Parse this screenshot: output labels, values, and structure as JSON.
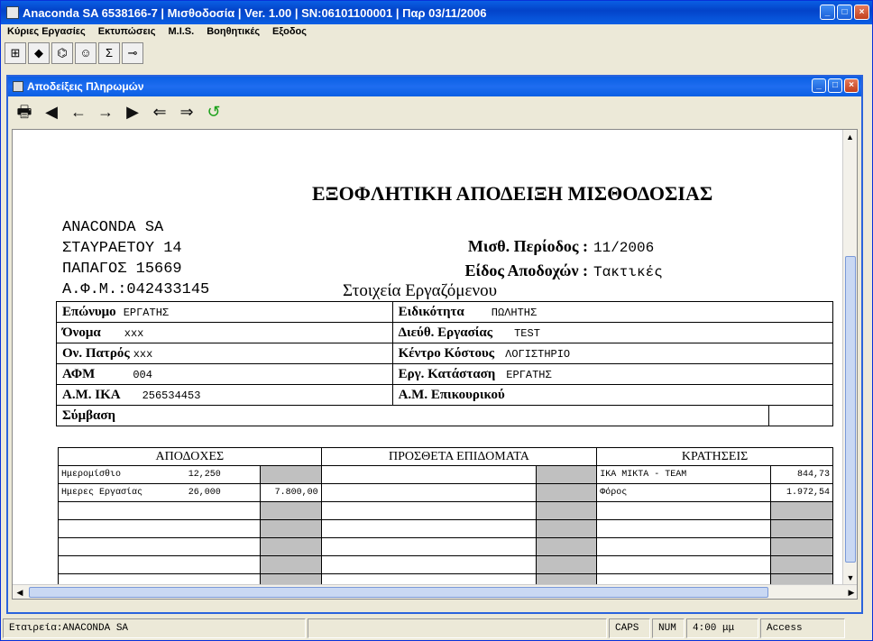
{
  "app": {
    "title": "Anaconda SA 6538166-7 | Μισθοδοσία | Ver. 1.00 | SN:06101100001 | Παρ 03/11/2006",
    "menu": [
      "Κύριες Εργασίες",
      "Εκτυπώσεις",
      "M.I.S.",
      "Βοηθητικές",
      "Εξοδος"
    ],
    "toolbar_icons": [
      "tree-icon",
      "export-icon",
      "network-icon",
      "smiley-icon",
      "sigma-icon",
      "key-icon"
    ],
    "toolbar_glyphs": [
      "⊞",
      "◆",
      "⌬",
      "☺",
      "Σ",
      "⊸"
    ]
  },
  "child": {
    "title": "Αποδείξεις Πληρωμών",
    "nav_glyphs": [
      "🖶",
      "◀",
      "←",
      "→",
      "▶",
      "⇐",
      "⇒",
      "↺"
    ]
  },
  "doc": {
    "title": "ΕΞΟΦΛΗΤΙΚΗ ΑΠΟΔΕΙΞΗ ΜΙΣΘΟΔΟΣΙΑΣ",
    "company": [
      "ANACONDA SA",
      "ΣΤΑΥΡΑΕΤΟΥ 14",
      "ΠΑΠΑΓΟΣ 15669",
      "Α.Φ.Μ.:042433145"
    ],
    "period_label": "Μισθ. Περίοδος :",
    "period_value": "11/2006",
    "earnings_type_label": "Είδος Αποδοχών :",
    "earnings_type_value": "Τακτικές",
    "employee_section": "Στοιχεία Εργαζόμενου",
    "employee": {
      "surname_label": "Επώνυμο",
      "surname": "ΕΡΓΑΤΗΣ",
      "specialty_label": "Ειδικότητα",
      "specialty": "ΠΩΛΗΤΗΣ",
      "name_label": "Όνομα",
      "name": "xxx",
      "work_addr_label": "Διεύθ. Εργασίας",
      "work_addr": "TEST",
      "father_label": "Ον. Πατρός",
      "father": "xxx",
      "cost_center_label": "Κέντρο Κόστους",
      "cost_center": "ΛΟΓΙΣΤΗΡΙΟ",
      "afm_label": "ΑΦΜ",
      "afm": "004",
      "status_label": "Εργ. Κατάσταση",
      "status": "ΕΡΓΑΤΗΣ",
      "ika_label": "Α.Μ. ΙΚΑ",
      "ika": "256534453",
      "aux_label": "Α.Μ. Επικουρικού",
      "contract_label": "Σύμβαση"
    },
    "pay": {
      "headers": [
        "ΑΠΟΔΟΧΕΣ",
        "ΠΡΟΣΘΕΤΑ ΕΠΙΔΟΜΑΤΑ",
        "ΚΡΑΤΗΣΕΙΣ"
      ],
      "rows": [
        {
          "e_label": "Ημερομίσθιο",
          "e_qty": "12,250",
          "e_amt": "",
          "d_label": "ΙΚΑ ΜΙΚΤΑ - ΤΕΑΜ",
          "d_amt": "844,73"
        },
        {
          "e_label": "Ημερες Εργασίας",
          "e_qty": "26,000",
          "e_amt": "7.800,00",
          "d_label": "Φόρος",
          "d_amt": "1.972,54"
        }
      ]
    }
  },
  "status": {
    "company": "Εταιρεία:ANACONDA SA",
    "caps": "CAPS",
    "num": "NUM",
    "time": "4:00 μμ",
    "db": "Access"
  }
}
